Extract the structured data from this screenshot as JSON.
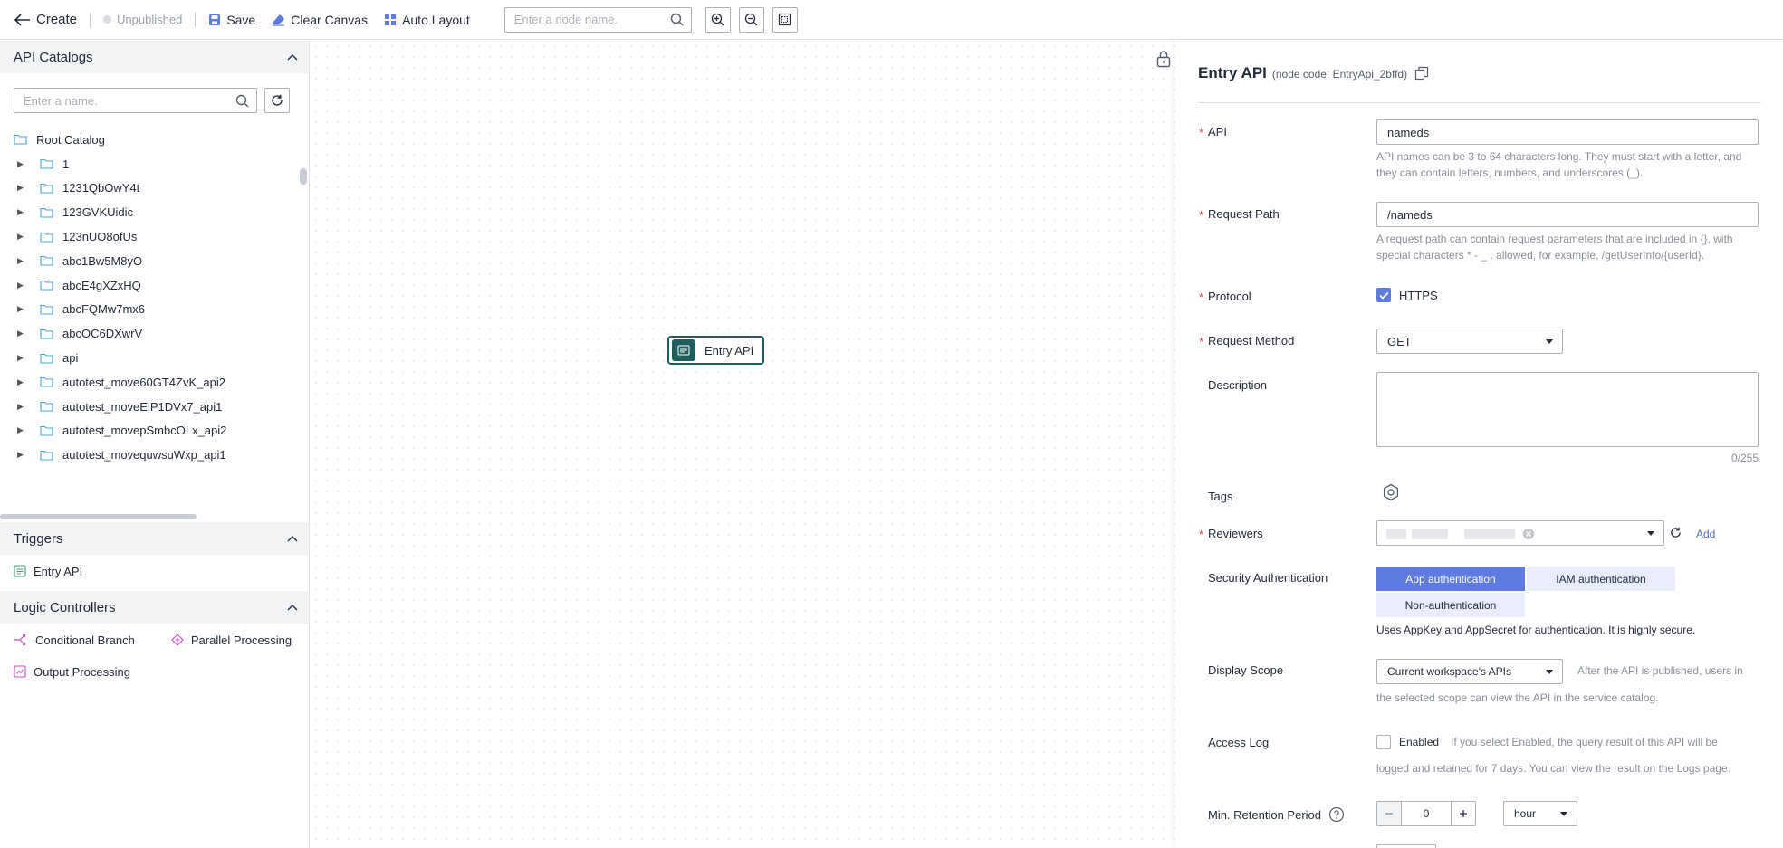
{
  "toolbar": {
    "back_label": "Create",
    "status": "Unpublished",
    "save_label": "Save",
    "clear_label": "Clear Canvas",
    "auto_layout_label": "Auto Layout",
    "search_placeholder": "Enter a node name."
  },
  "left": {
    "catalogs_title": "API Catalogs",
    "search_placeholder": "Enter a name.",
    "root_label": "Root Catalog",
    "catalogs": [
      "1",
      "1231QbOwY4t",
      "123GVKUidic",
      "123nUO8ofUs",
      "abc1Bw5M8yO",
      "abcE4gXZxHQ",
      "abcFQMw7mx6",
      "abcOC6DXwrV",
      "api",
      "autotest_move60GT4ZvK_api2",
      "autotest_moveEiP1DVx7_api1",
      "autotest_movepSmbcOLx_api2",
      "autotest_movequwsuWxp_api1"
    ],
    "triggers_title": "Triggers",
    "trigger_entry": "Entry API",
    "logic_title": "Logic Controllers",
    "logic_items": [
      "Conditional Branch",
      "Parallel Processing",
      "Output Processing"
    ]
  },
  "canvas": {
    "node_label": "Entry API"
  },
  "panel": {
    "title": "Entry API",
    "node_code": "(node code: EntryApi_2bffd)",
    "api_label": "API",
    "api_value": "nameds",
    "api_hint_1": "API names can be 3 to 64 characters long. They must start with a letter, and",
    "api_hint_2": "they can contain letters, numbers, and underscores (_).",
    "path_label": "Request Path",
    "path_value": "/nameds",
    "path_hint_1": "A request path can contain request parameters that are included in {}, with",
    "path_hint_2": "special characters * - _ . allowed, for example, /getUserInfo/{userId}.",
    "protocol_label": "Protocol",
    "protocol_value": "HTTPS",
    "method_label": "Request Method",
    "method_value": "GET",
    "description_label": "Description",
    "description_counter": "0/255",
    "tags_label": "Tags",
    "reviewers_label": "Reviewers",
    "add_label": "Add",
    "security_label": "Security Authentication",
    "auth_app": "App authentication",
    "auth_iam": "IAM authentication",
    "auth_none": "Non-authentication",
    "auth_hint": "Uses AppKey and AppSecret for authentication. It is highly secure.",
    "scope_label": "Display Scope",
    "scope_value": "Current workspace's APIs",
    "scope_hint_1": "After the API is published, users in",
    "scope_hint_2": "the selected scope can view the API in the service catalog.",
    "access_log_label": "Access Log",
    "access_log_value": "Enabled",
    "access_log_hint_1": "If you select Enabled, the query result of this API will be",
    "access_log_hint_2": "logged and retained for 7 days. You can view the result on the Logs page.",
    "retention_label": "Min. Retention Period",
    "retention_value": "0",
    "retention_unit": "hour"
  },
  "colors": {
    "accent": "#5e7ce0",
    "node": "#1f5e5e",
    "required": "#e2455a"
  }
}
